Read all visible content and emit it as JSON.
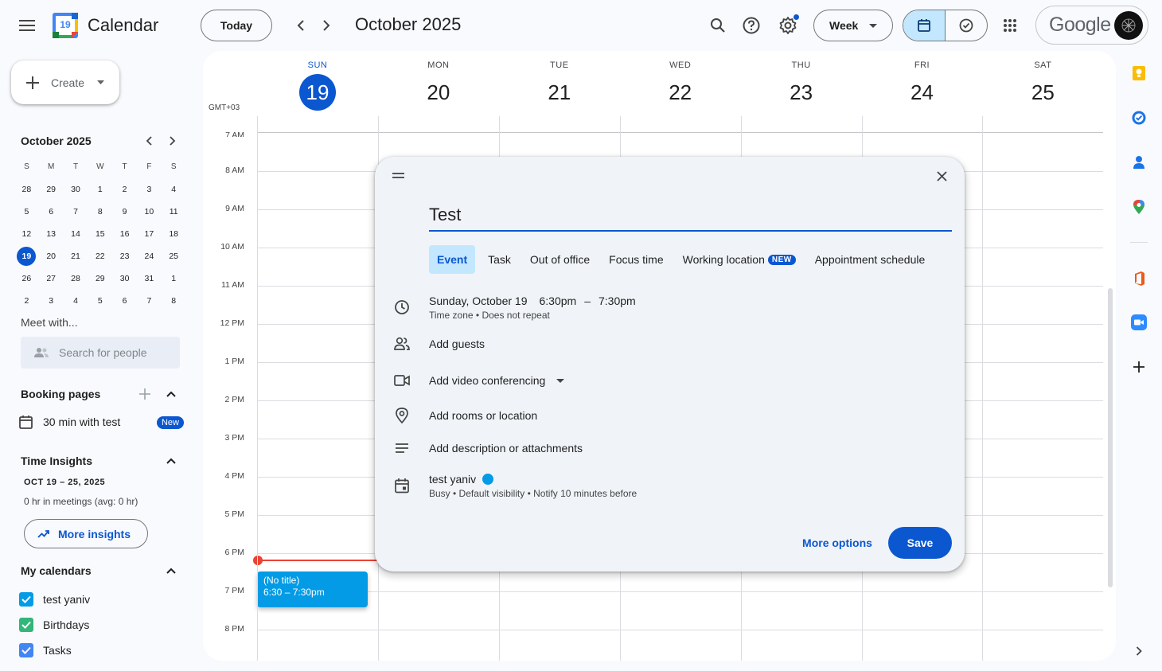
{
  "app": {
    "name": "Calendar",
    "logo_day": "19"
  },
  "header": {
    "today_label": "Today",
    "month_title": "October 2025",
    "view_label": "Week",
    "account_brand": "Google"
  },
  "sidebar": {
    "create_label": "Create",
    "mini_calendar": {
      "title": "October 2025",
      "weekday_heads": [
        "S",
        "M",
        "T",
        "W",
        "T",
        "F",
        "S"
      ],
      "weeks": [
        [
          "28",
          "29",
          "30",
          "1",
          "2",
          "3",
          "4"
        ],
        [
          "5",
          "6",
          "7",
          "8",
          "9",
          "10",
          "11"
        ],
        [
          "12",
          "13",
          "14",
          "15",
          "16",
          "17",
          "18"
        ],
        [
          "19",
          "20",
          "21",
          "22",
          "23",
          "24",
          "25"
        ],
        [
          "26",
          "27",
          "28",
          "29",
          "30",
          "31",
          "1"
        ],
        [
          "2",
          "3",
          "4",
          "5",
          "6",
          "7",
          "8"
        ]
      ],
      "selected": "19"
    },
    "meet_with_label": "Meet with...",
    "people_search_placeholder": "Search for people",
    "booking_pages": {
      "title": "Booking pages",
      "item": "30 min with test",
      "badge": "New"
    },
    "time_insights": {
      "title": "Time Insights",
      "range": "OCT 19 – 25, 2025",
      "summary": "0 hr in meetings (avg: 0 hr)",
      "button": "More insights"
    },
    "my_calendars": {
      "title": "My calendars",
      "items": [
        {
          "label": "test yaniv",
          "color": "#039be5"
        },
        {
          "label": "Birthdays",
          "color": "#33b679"
        },
        {
          "label": "Tasks",
          "color": "#4285f4"
        }
      ]
    }
  },
  "week": {
    "timezone": "GMT+03",
    "days": [
      {
        "name": "SUN",
        "num": "19",
        "today": true
      },
      {
        "name": "MON",
        "num": "20"
      },
      {
        "name": "TUE",
        "num": "21"
      },
      {
        "name": "WED",
        "num": "22"
      },
      {
        "name": "THU",
        "num": "23"
      },
      {
        "name": "FRI",
        "num": "24"
      },
      {
        "name": "SAT",
        "num": "25"
      }
    ],
    "hours": [
      "7 AM",
      "8 AM",
      "9 AM",
      "10 AM",
      "11 AM",
      "12 PM",
      "1 PM",
      "2 PM",
      "3 PM",
      "4 PM",
      "5 PM",
      "6 PM",
      "7 PM",
      "8 PM"
    ],
    "event": {
      "title": "(No title)",
      "time": "6:30 – 7:30pm"
    }
  },
  "dialog": {
    "title_value": "Test",
    "tabs": [
      "Event",
      "Task",
      "Out of office",
      "Focus time",
      "Working location",
      "Appointment schedule"
    ],
    "new_badge": "NEW",
    "date": "Sunday, October 19",
    "start": "6:30pm",
    "dash": "–",
    "end": "7:30pm",
    "tz_repeat": "Time zone • Does not repeat",
    "guests": "Add guests",
    "video": "Add video conferencing",
    "location": "Add rooms or location",
    "description": "Add description or attachments",
    "calendar_name": "test yaniv",
    "calendar_color": "#039be5",
    "calendar_details": "Busy • Default visibility • Notify 10 minutes before",
    "more_options": "More options",
    "save": "Save"
  },
  "colors": {
    "accent": "#0b57d0",
    "now_line": "#ea4335",
    "event": "#039be5"
  }
}
